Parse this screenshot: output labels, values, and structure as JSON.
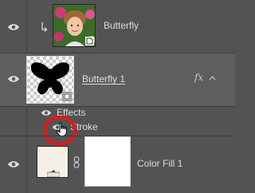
{
  "layers": {
    "butterfly_photo": {
      "name": "Butterfly"
    },
    "butterfly_1": {
      "name": "Butterfly 1",
      "fx_badge": "fx"
    },
    "effects": {
      "label": "Effects",
      "stroke_label": "Stroke"
    },
    "color_fill": {
      "name": "Color Fill 1",
      "fill_color": "#f5efe6"
    }
  },
  "colors": {
    "panel_bg": "#535353",
    "selected_row_bg": "#5e5e5e",
    "highlight_ring": "#d91c1c"
  },
  "icons": [
    "eye-icon",
    "clipping-arrow-icon",
    "smart-object-icon",
    "fx-icon",
    "chevron-up-icon",
    "link-chain-icon",
    "hand-cursor-icon"
  ]
}
